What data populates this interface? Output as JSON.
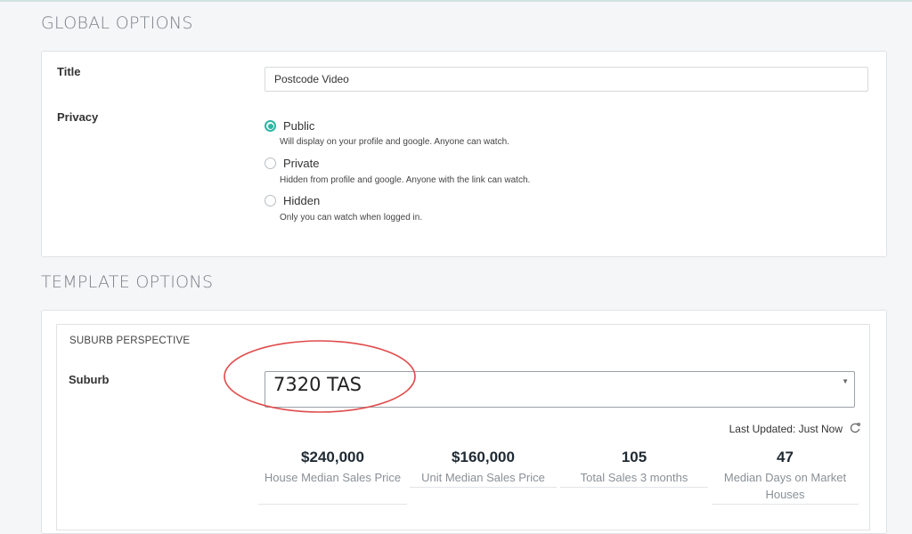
{
  "global_options": {
    "heading": "GLOBAL OPTIONS",
    "title_label": "Title",
    "title_value": "Postcode Video",
    "privacy_label": "Privacy",
    "privacy_options": [
      {
        "label": "Public",
        "description": "Will display on your profile and google. Anyone can watch.",
        "selected": true
      },
      {
        "label": "Private",
        "description": "Hidden from profile and google. Anyone with the link can watch.",
        "selected": false
      },
      {
        "label": "Hidden",
        "description": "Only you can watch when logged in.",
        "selected": false
      }
    ]
  },
  "template_options": {
    "heading": "TEMPLATE OPTIONS",
    "subsection_heading": "SUBURB PERSPECTIVE",
    "suburb_label": "Suburb",
    "suburb_value": "7320 TAS",
    "last_updated": "Last Updated: Just Now",
    "stats": [
      {
        "value": "$240,000",
        "label": "House Median Sales Price"
      },
      {
        "value": "$160,000",
        "label": "Unit Median Sales Price"
      },
      {
        "value": "105",
        "label": "Total Sales 3 months"
      },
      {
        "value": "47",
        "label": "Median Days on Market Houses"
      }
    ]
  },
  "colors": {
    "accent": "#2bb5a3",
    "annotation": "#e04a4a"
  },
  "icons": {
    "refresh": "refresh-icon",
    "dropdown": "caret-down-icon"
  }
}
